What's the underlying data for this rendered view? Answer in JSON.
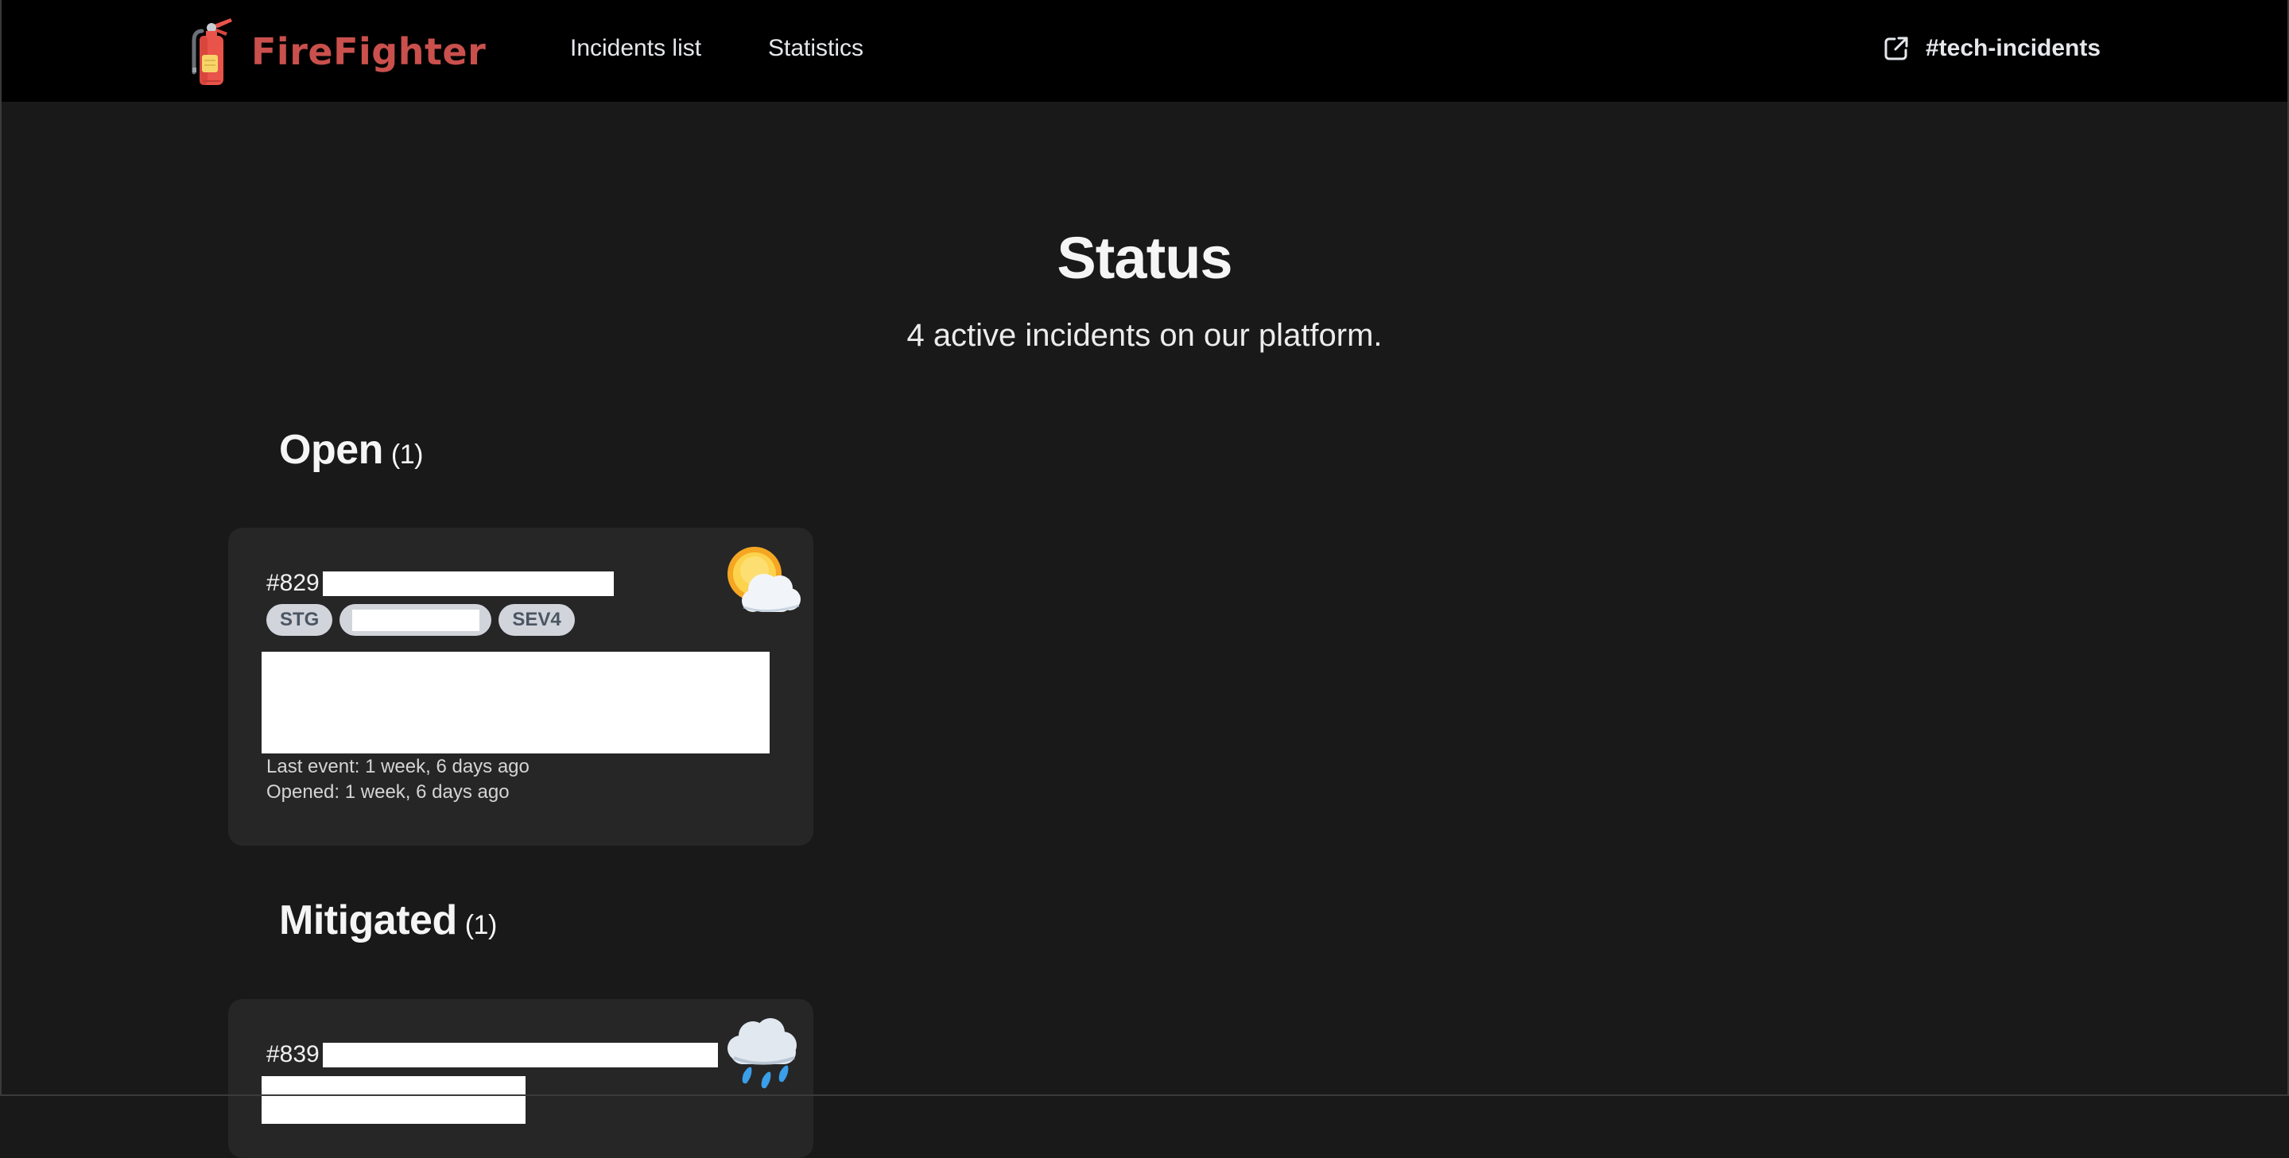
{
  "navbar": {
    "brand": {
      "name": "FireFighter",
      "icon": "fire-extinguisher-icon",
      "color": "#c9504c"
    },
    "links": [
      {
        "label": "Incidents list"
      },
      {
        "label": "Statistics"
      }
    ],
    "channel": {
      "label": "#tech-incidents",
      "icon": "external-link-icon"
    }
  },
  "header": {
    "title": "Status",
    "subtitle": "4 active incidents on our platform."
  },
  "sections": [
    {
      "title": "Open",
      "count": "(1)",
      "incidents": [
        {
          "id": "#829",
          "title": "[redacted]",
          "tags": [
            "STG",
            "[redacted]",
            "SEV4"
          ],
          "weather_icon": "sun-behind-cloud-icon",
          "description": "[redacted]",
          "last_event": "Last event: 1 week, 6 days ago",
          "opened": "Opened: 1 week, 6 days ago"
        }
      ]
    },
    {
      "title": "Mitigated",
      "count": "(1)",
      "incidents": [
        {
          "id": "#839",
          "title": "[redacted]",
          "weather_icon": "cloud-with-rain-icon",
          "description": "[redacted]"
        }
      ]
    }
  ],
  "colors": {
    "background": "#191919",
    "navbar": "#000000",
    "card": "#262626",
    "tag_bg": "#d1d5db",
    "tag_text": "#4b5563"
  }
}
